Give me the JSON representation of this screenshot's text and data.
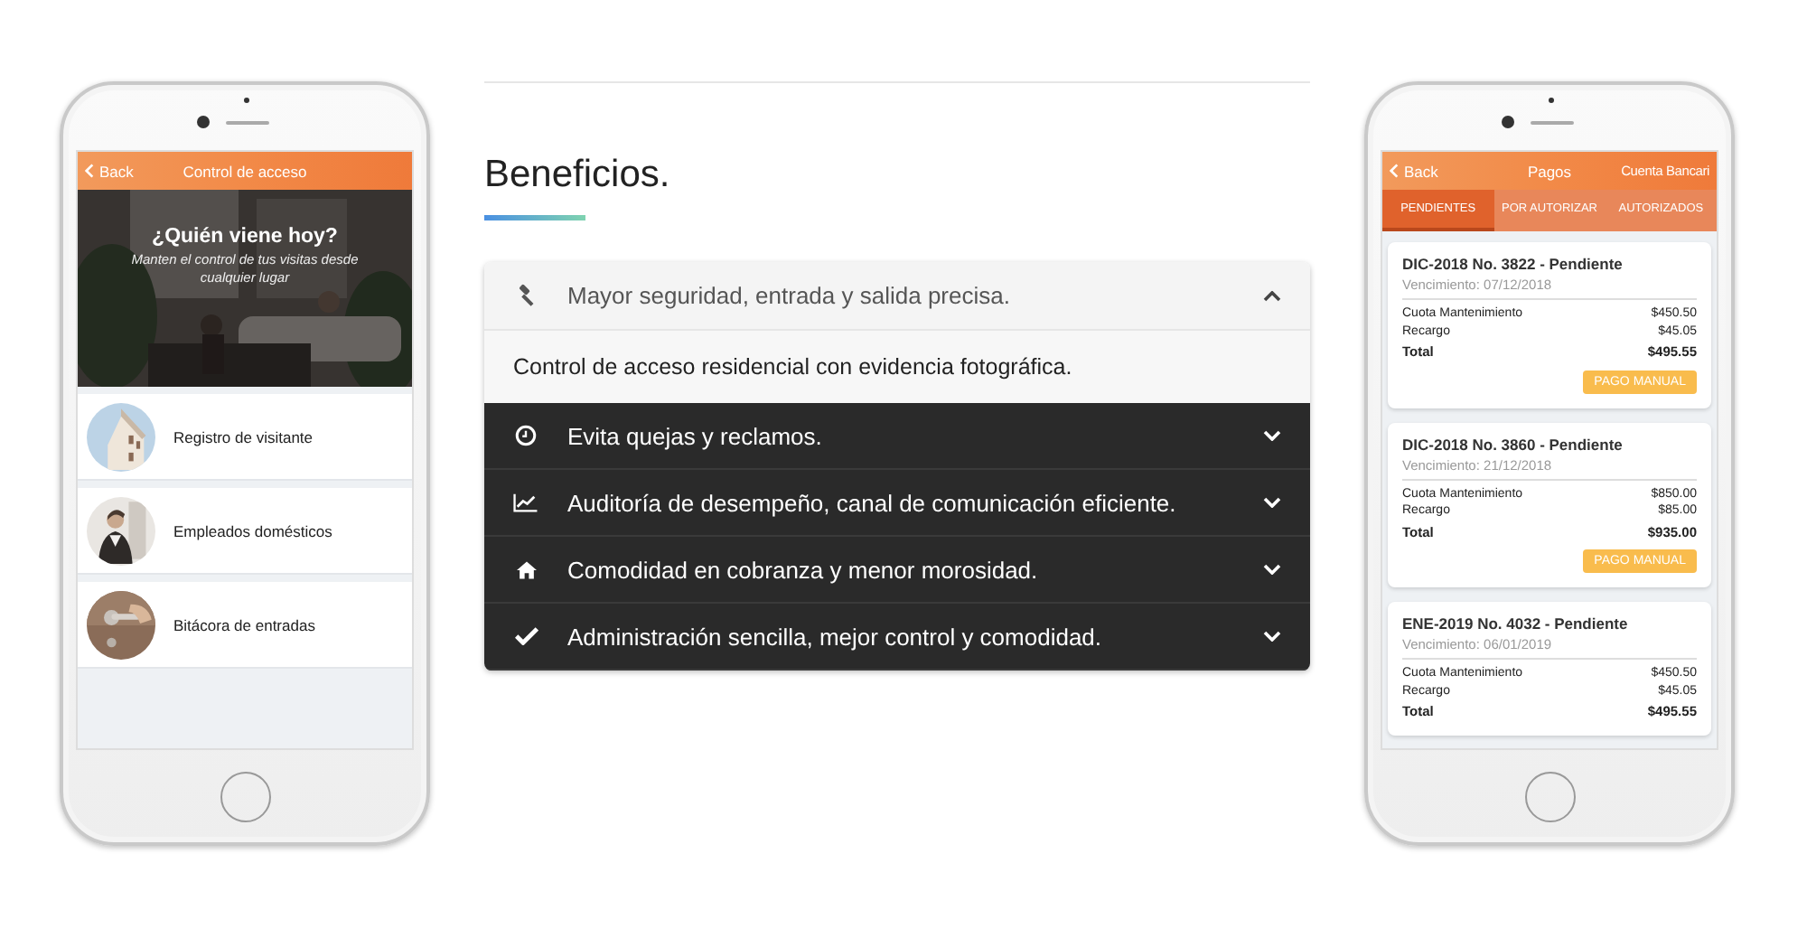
{
  "left_phone": {
    "header": {
      "back": "Back",
      "title": "Control de acceso"
    },
    "hero": {
      "title": "¿Quién viene hoy?",
      "subtitle": "Manten el control de tus visitas desde cualquier lugar"
    },
    "menu": [
      {
        "label": "Registro de visitante"
      },
      {
        "label": "Empleados domésticos"
      },
      {
        "label": "Bitácora de entradas"
      }
    ]
  },
  "benefits": {
    "title": "Beneficios.",
    "items": [
      {
        "label": "Mayor seguridad, entrada y salida precisa.",
        "expanded": true,
        "body": "Control de acceso residencial con evidencia fotográfica."
      },
      {
        "label": "Evita quejas y reclamos.",
        "expanded": false
      },
      {
        "label": "Auditoría de desempeño, canal de comunicación eficiente.",
        "expanded": false
      },
      {
        "label": "Comodidad en cobranza y menor morosidad.",
        "expanded": false
      },
      {
        "label": "Administración sencilla, mejor control y comodidad.",
        "expanded": false
      }
    ]
  },
  "right_phone": {
    "header": {
      "back": "Back",
      "title": "Pagos",
      "action": "Cuenta Bancari"
    },
    "tabs": [
      {
        "label": "PENDIENTES",
        "selected": true
      },
      {
        "label": "POR AUTORIZAR",
        "selected": false
      },
      {
        "label": "AUTORIZADOS",
        "selected": false
      }
    ],
    "payments": [
      {
        "title": "DIC-2018 No. 3822 - Pendiente",
        "due": "Vencimiento: 07/12/2018",
        "lines": [
          {
            "label": "Cuota Mantenimiento",
            "amount": "$450.50"
          },
          {
            "label": "Recargo",
            "amount": "$45.05"
          }
        ],
        "total_label": "Total",
        "total": "$495.55",
        "button": "PAGO MANUAL"
      },
      {
        "title": "DIC-2018 No. 3860 - Pendiente",
        "due": "Vencimiento: 21/12/2018",
        "lines": [
          {
            "label": "Cuota Mantenimiento",
            "amount": "$850.00"
          },
          {
            "label": "Recargo",
            "amount": "$85.00"
          }
        ],
        "total_label": "Total",
        "total": "$935.00",
        "button": "PAGO MANUAL"
      },
      {
        "title": "ENE-2019 No. 4032 - Pendiente",
        "due": "Vencimiento: 06/01/2019",
        "lines": [
          {
            "label": "Cuota Mantenimiento",
            "amount": "$450.50"
          },
          {
            "label": "Recargo",
            "amount": "$45.05"
          }
        ],
        "total_label": "Total",
        "total": "$495.55"
      }
    ]
  }
}
